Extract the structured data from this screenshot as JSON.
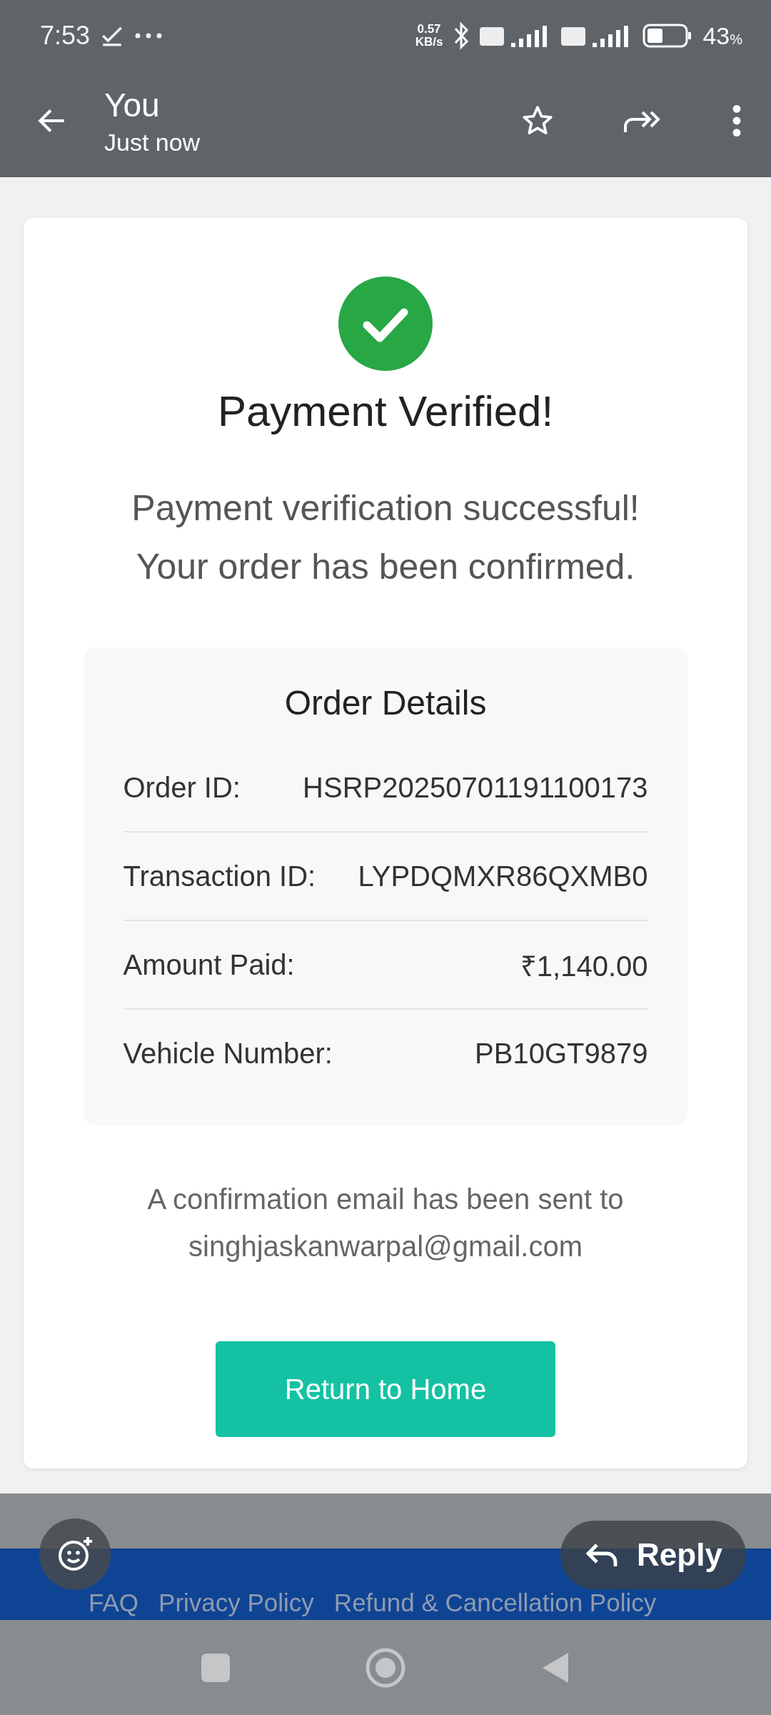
{
  "status_bar": {
    "time": "7:53",
    "speed_value": "0.57",
    "speed_unit": "KB/s",
    "battery": "43",
    "battery_unit": "%"
  },
  "toolbar": {
    "sender": "You",
    "time": "Just now"
  },
  "message": {
    "title": "Payment Verified!",
    "text": "Payment verification successful! Your order has been confirmed.",
    "details": {
      "title": "Order Details",
      "rows": [
        {
          "label": "Order ID:",
          "value": "HSRP20250701191100173"
        },
        {
          "label": "Transaction ID:",
          "value": "LYPDQMXR86QXMB0"
        },
        {
          "label": "Amount Paid:",
          "value": "₹1,140.00"
        },
        {
          "label": "Vehicle Number:",
          "value": "PB10GT9879"
        }
      ]
    },
    "email_note": "A confirmation email has been sent to",
    "email": "singhjaskanwarpal@gmail.com",
    "button": "Return to Home"
  },
  "footer_links": [
    "FAQ",
    "Privacy Policy",
    "Refund & Cancellation Policy"
  ],
  "reply_button": "Reply"
}
